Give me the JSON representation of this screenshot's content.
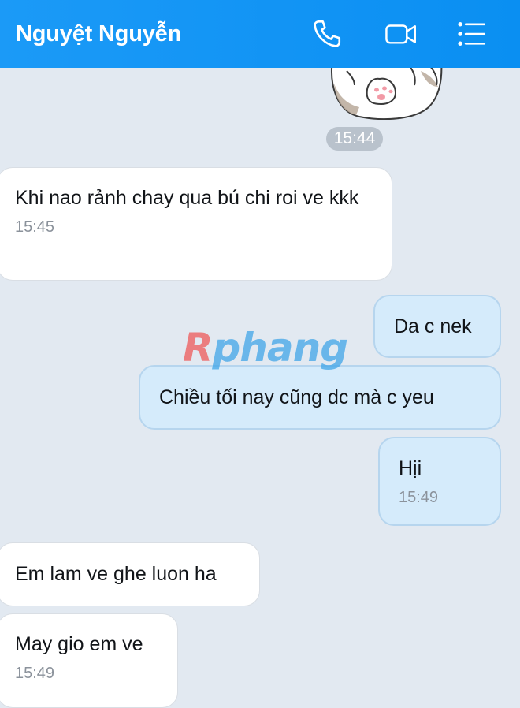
{
  "header": {
    "contact_name": "Nguyệt Nguyễn",
    "call_icon": "phone-icon",
    "video_icon": "video-camera-icon",
    "menu_icon": "list-menu-icon",
    "background": "#0f93f4"
  },
  "chat": {
    "sticker_time": "15:44",
    "messages": [
      {
        "side": "incoming",
        "text": "Khi nao rảnh chay qua bú chi roi ve kkk",
        "time": "15:45"
      },
      {
        "side": "outgoing",
        "text": "Da c nek",
        "time": ""
      },
      {
        "side": "outgoing",
        "text": "Chiều tối nay cũng dc mà c yeu",
        "time": ""
      },
      {
        "side": "outgoing",
        "text": "Hịi",
        "time": "15:49"
      },
      {
        "side": "incoming",
        "text": "Em lam ve ghe luon ha",
        "time": ""
      },
      {
        "side": "incoming",
        "text": "May gio em ve",
        "time": "15:49"
      }
    ]
  },
  "watermark": {
    "first": "R",
    "rest": "phang"
  },
  "colors": {
    "chat_background": "#e2e9f1",
    "incoming_bubble": "#ffffff",
    "outgoing_bubble": "#d5ebfb"
  }
}
